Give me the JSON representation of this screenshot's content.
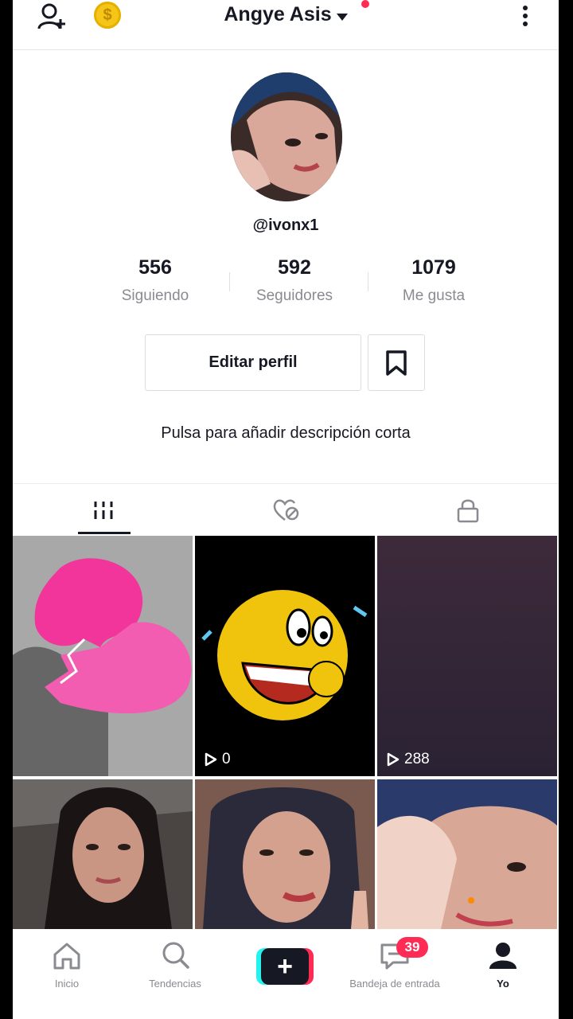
{
  "header": {
    "title": "Angye Asis",
    "icons": [
      "add-user-icon",
      "coin-icon",
      "chevron-down-icon",
      "more-icon"
    ]
  },
  "profile": {
    "handle": "@ivonx1",
    "stats": [
      {
        "value": "556",
        "label": "Siguiendo"
      },
      {
        "value": "592",
        "label": "Seguidores"
      },
      {
        "value": "1079",
        "label": "Me gusta"
      }
    ],
    "edit_label": "Editar perfil",
    "bio_prompt": "Pulsa para añadir descripción corta"
  },
  "tabs": [
    "grid-icon",
    "liked-hidden-icon",
    "lock-icon"
  ],
  "grid": [
    {
      "views": ""
    },
    {
      "views": "0"
    },
    {
      "views": "288"
    },
    {
      "views": ""
    },
    {
      "views": ""
    },
    {
      "views": ""
    }
  ],
  "nav": {
    "items": [
      {
        "label": "Inicio",
        "icon": "home-icon"
      },
      {
        "label": "Tendencias",
        "icon": "search-icon"
      },
      {
        "label": "",
        "icon": "plus-icon"
      },
      {
        "label": "Bandeja de entrada",
        "icon": "inbox-icon"
      },
      {
        "label": "Yo",
        "icon": "profile-icon"
      }
    ],
    "inbox_badge": "39"
  },
  "colors": {
    "accent": "#fe2c55",
    "cyan": "#25f4ee",
    "text": "#161823",
    "muted": "#8a8b91"
  }
}
